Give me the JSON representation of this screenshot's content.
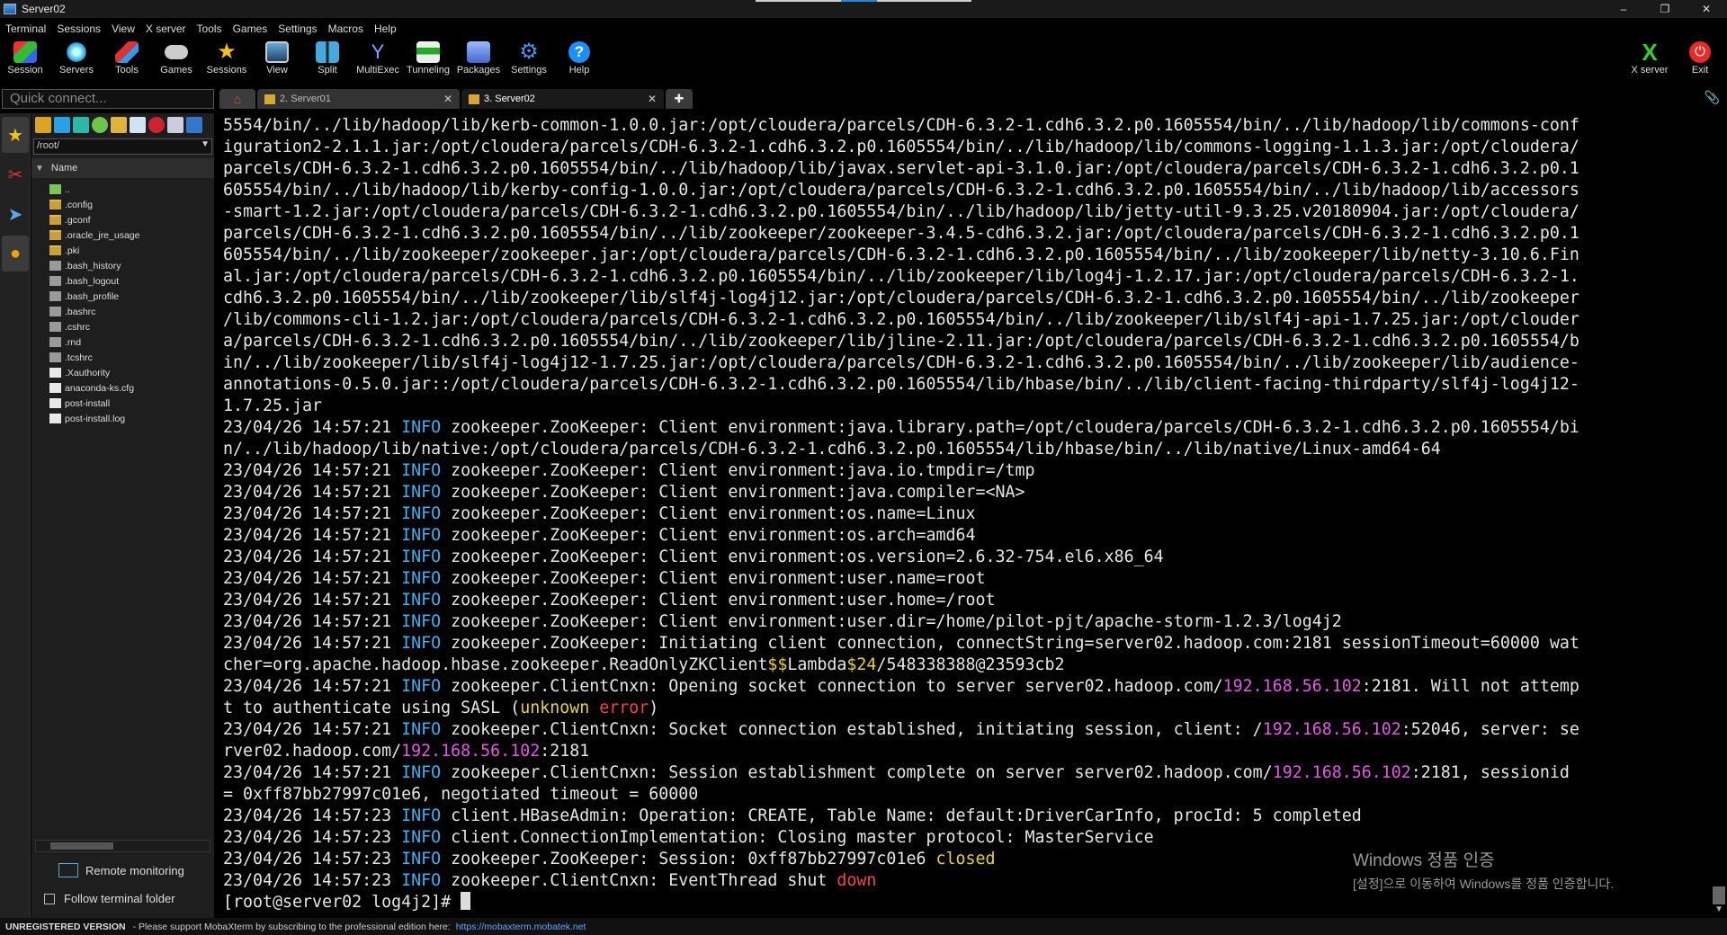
{
  "window": {
    "title": "Server02",
    "controls": [
      "–",
      "❐",
      "✕"
    ]
  },
  "menu": [
    "Terminal",
    "Sessions",
    "View",
    "X server",
    "Tools",
    "Games",
    "Settings",
    "Macros",
    "Help"
  ],
  "toolbar": {
    "session": "Session",
    "servers": "Servers",
    "tools": "Tools",
    "games": "Games",
    "sessions": "Sessions",
    "view": "View",
    "split": "Split",
    "multiexec": "MultiExec",
    "tunneling": "Tunneling",
    "packages": "Packages",
    "settings": "Settings",
    "help": "Help",
    "xserver": "X server",
    "exit": "Exit"
  },
  "quick_connect": {
    "placeholder": "Quick connect..."
  },
  "sidebar": {
    "path": "/root/",
    "column_name": "Name",
    "files": [
      {
        "name": "..",
        "type": "up"
      },
      {
        "name": ".config",
        "type": "folder"
      },
      {
        "name": ".gconf",
        "type": "folder"
      },
      {
        "name": ".oracle_jre_usage",
        "type": "folder"
      },
      {
        "name": ".pki",
        "type": "folder"
      },
      {
        "name": ".bash_history",
        "type": "gray"
      },
      {
        "name": ".bash_logout",
        "type": "gray"
      },
      {
        "name": ".bash_profile",
        "type": "gray"
      },
      {
        "name": ".bashrc",
        "type": "gray"
      },
      {
        "name": ".cshrc",
        "type": "gray"
      },
      {
        "name": ".rnd",
        "type": "gray"
      },
      {
        "name": ".tcshrc",
        "type": "gray"
      },
      {
        "name": ".Xauthority",
        "type": "doc"
      },
      {
        "name": "anaconda-ks.cfg",
        "type": "doc"
      },
      {
        "name": "post-install",
        "type": "doc"
      },
      {
        "name": "post-install.log",
        "type": "doc"
      }
    ],
    "remote_monitoring": "Remote monitoring",
    "follow_terminal": "Follow terminal folder"
  },
  "tabs": {
    "server01": "2. Server01",
    "server02": "3. Server02",
    "close": "✕"
  },
  "terminal": {
    "lines": [
      "5554/bin/../lib/hadoop/lib/kerb-common-1.0.0.jar:/opt/cloudera/parcels/CDH-6.3.2-1.cdh6.3.2.p0.1605554/bin/../lib/hadoop/lib/commons-conf",
      "iguration2-2.1.1.jar:/opt/cloudera/parcels/CDH-6.3.2-1.cdh6.3.2.p0.1605554/bin/../lib/hadoop/lib/commons-logging-1.1.3.jar:/opt/cloudera/",
      "parcels/CDH-6.3.2-1.cdh6.3.2.p0.1605554/bin/../lib/hadoop/lib/javax.servlet-api-3.1.0.jar:/opt/cloudera/parcels/CDH-6.3.2-1.cdh6.3.2.p0.1",
      "605554/bin/../lib/hadoop/lib/kerby-config-1.0.0.jar:/opt/cloudera/parcels/CDH-6.3.2-1.cdh6.3.2.p0.1605554/bin/../lib/hadoop/lib/accessors",
      "-smart-1.2.jar:/opt/cloudera/parcels/CDH-6.3.2-1.cdh6.3.2.p0.1605554/bin/../lib/hadoop/lib/jetty-util-9.3.25.v20180904.jar:/opt/cloudera/",
      "parcels/CDH-6.3.2-1.cdh6.3.2.p0.1605554/bin/../lib/zookeeper/zookeeper-3.4.5-cdh6.3.2.jar:/opt/cloudera/parcels/CDH-6.3.2-1.cdh6.3.2.p0.1",
      "605554/bin/../lib/zookeeper/zookeeper.jar:/opt/cloudera/parcels/CDH-6.3.2-1.cdh6.3.2.p0.1605554/bin/../lib/zookeeper/lib/netty-3.10.6.Fin",
      "al.jar:/opt/cloudera/parcels/CDH-6.3.2-1.cdh6.3.2.p0.1605554/bin/../lib/zookeeper/lib/log4j-1.2.17.jar:/opt/cloudera/parcels/CDH-6.3.2-1.",
      "cdh6.3.2.p0.1605554/bin/../lib/zookeeper/lib/slf4j-log4j12.jar:/opt/cloudera/parcels/CDH-6.3.2-1.cdh6.3.2.p0.1605554/bin/../lib/zookeeper",
      "/lib/commons-cli-1.2.jar:/opt/cloudera/parcels/CDH-6.3.2-1.cdh6.3.2.p0.1605554/bin/../lib/zookeeper/lib/slf4j-api-1.7.25.jar:/opt/clouder",
      "a/parcels/CDH-6.3.2-1.cdh6.3.2.p0.1605554/bin/../lib/zookeeper/lib/jline-2.11.jar:/opt/cloudera/parcels/CDH-6.3.2-1.cdh6.3.2.p0.1605554/b",
      "in/../lib/zookeeper/lib/slf4j-log4j12-1.7.25.jar:/opt/cloudera/parcels/CDH-6.3.2-1.cdh6.3.2.p0.1605554/bin/../lib/zookeeper/lib/audience-",
      "annotations-0.5.0.jar::/opt/cloudera/parcels/CDH-6.3.2-1.cdh6.3.2.p0.1605554/lib/hbase/bin/../lib/client-facing-thirdparty/slf4j-log4j12-",
      "1.7.25.jar"
    ],
    "log": [
      {
        "ts": "23/04/26 14:57:21 ",
        "lvl": "INFO",
        "msg": " zookeeper.ZooKeeper: Client environment:java.library.path=/opt/cloudera/parcels/CDH-6.3.2-1.cdh6.3.2.p0.1605554/bi"
      },
      {
        "cont": "n/../lib/hadoop/lib/native:/opt/cloudera/parcels/CDH-6.3.2-1.cdh6.3.2.p0.1605554/lib/hbase/bin/../lib/native/Linux-amd64-64"
      },
      {
        "ts": "23/04/26 14:57:21 ",
        "lvl": "INFO",
        "msg": " zookeeper.ZooKeeper: Client environment:java.io.tmpdir=/tmp"
      },
      {
        "ts": "23/04/26 14:57:21 ",
        "lvl": "INFO",
        "msg": " zookeeper.ZooKeeper: Client environment:java.compiler=<NA>"
      },
      {
        "ts": "23/04/26 14:57:21 ",
        "lvl": "INFO",
        "msg": " zookeeper.ZooKeeper: Client environment:os.name=Linux"
      },
      {
        "ts": "23/04/26 14:57:21 ",
        "lvl": "INFO",
        "msg": " zookeeper.ZooKeeper: Client environment:os.arch=amd64"
      },
      {
        "ts": "23/04/26 14:57:21 ",
        "lvl": "INFO",
        "msg": " zookeeper.ZooKeeper: Client environment:os.version=2.6.32-754.el6.x86_64"
      },
      {
        "ts": "23/04/26 14:57:21 ",
        "lvl": "INFO",
        "msg": " zookeeper.ZooKeeper: Client environment:user.name=root"
      },
      {
        "ts": "23/04/26 14:57:21 ",
        "lvl": "INFO",
        "msg": " zookeeper.ZooKeeper: Client environment:user.home=/root"
      },
      {
        "ts": "23/04/26 14:57:21 ",
        "lvl": "INFO",
        "msg": " zookeeper.ZooKeeper: Client environment:user.dir=/home/pilot-pjt/apache-storm-1.2.3/log4j2"
      },
      {
        "ts": "23/04/26 14:57:21 ",
        "lvl": "INFO",
        "msg": " zookeeper.ZooKeeper: Initiating client connection, connectString=server02.hadoop.com:2181 sessionTimeout=60000 wat"
      },
      {
        "cont_parts": [
          [
            "cher=org.apache.hadoop.hbase.zookeeper.ReadOnlyZKClient",
            ""
          ],
          [
            "$$",
            "yel"
          ],
          [
            "Lambda",
            ""
          ],
          [
            "$24",
            "yel"
          ],
          [
            "/548338388@23593cb2",
            ""
          ]
        ]
      },
      {
        "ts": "23/04/26 14:57:21 ",
        "lvl": "INFO",
        "parts": [
          [
            " zookeeper.ClientCnxn: Opening socket connection to server server02.hadoop.com/",
            ""
          ],
          [
            "192.168.56.102",
            "ip"
          ],
          [
            ":2181. Will not attemp",
            ""
          ]
        ]
      },
      {
        "cont_parts": [
          [
            "t to authenticate using SASL (",
            ""
          ],
          [
            "unknown",
            "yel"
          ],
          [
            " ",
            ""
          ],
          [
            "error",
            "red"
          ],
          [
            ")",
            ""
          ]
        ]
      },
      {
        "ts": "23/04/26 14:57:21 ",
        "lvl": "INFO",
        "parts": [
          [
            " zookeeper.ClientCnxn: Socket connection established, initiating session, client: /",
            ""
          ],
          [
            "192.168.56.102",
            "ip"
          ],
          [
            ":52046, server: se",
            ""
          ]
        ]
      },
      {
        "cont_parts": [
          [
            "rver02.hadoop.com/",
            ""
          ],
          [
            "192.168.56.102",
            "ip"
          ],
          [
            ":2181",
            ""
          ]
        ]
      },
      {
        "ts": "23/04/26 14:57:21 ",
        "lvl": "INFO",
        "parts": [
          [
            " zookeeper.ClientCnxn: Session establishment complete on server server02.hadoop.com/",
            ""
          ],
          [
            "192.168.56.102",
            "ip"
          ],
          [
            ":2181, sessionid",
            ""
          ]
        ]
      },
      {
        "cont": "= 0xff87bb27997c01e6, negotiated timeout = 60000"
      },
      {
        "ts": "23/04/26 14:57:23 ",
        "lvl": "INFO",
        "msg": " client.HBaseAdmin: Operation: CREATE, Table Name: default:DriverCarInfo, procId: 5 completed"
      },
      {
        "ts": "23/04/26 14:57:23 ",
        "lvl": "INFO",
        "msg": " client.ConnectionImplementation: Closing master protocol: MasterService"
      },
      {
        "ts": "23/04/26 14:57:23 ",
        "lvl": "INFO",
        "parts": [
          [
            " zookeeper.ZooKeeper: Session: 0xff87bb27997c01e6 ",
            ""
          ],
          [
            "closed",
            "yel"
          ]
        ]
      },
      {
        "ts": "23/04/26 14:57:23 ",
        "lvl": "INFO",
        "parts": [
          [
            " zookeeper.ClientCnxn: EventThread shut ",
            ""
          ],
          [
            "down",
            "red"
          ]
        ]
      }
    ],
    "prompt": "[root@server02 log4j2]# "
  },
  "watermark": {
    "line1": "Windows 정품 인증",
    "line2": "[설정]으로 이동하여 Windows를 정품 인증합니다."
  },
  "status": {
    "unregistered": "UNREGISTERED VERSION",
    "message": " -  Please support MobaXterm by subscribing to the professional edition here:",
    "link": "https://mobaxterm.mobatek.net"
  },
  "colors": {
    "info": "#3fb0f0",
    "ip": "#e05be0",
    "highlight_yellow": "#e8d23a",
    "highlight_red": "#f04848",
    "accent": "#2a7fd8"
  }
}
